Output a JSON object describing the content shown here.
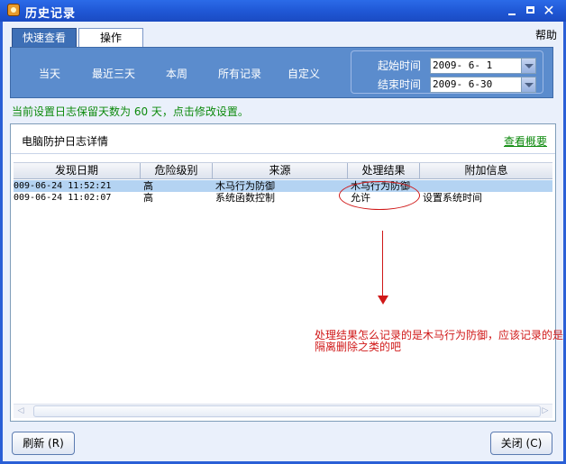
{
  "window": {
    "title": "历史记录",
    "help": "帮助"
  },
  "tabs": [
    {
      "label": "快速查看",
      "active": true
    },
    {
      "label": "操作",
      "active": false
    }
  ],
  "filter": {
    "ranges": [
      "当天",
      "最近三天",
      "本周",
      "所有记录",
      "自定义"
    ],
    "start_label": "起始时间",
    "start_value": "2009- 6- 1",
    "end_label": "结束时间",
    "end_value": "2009- 6-30"
  },
  "notice": "当前设置日志保留天数为 60 天，点击修改设置。",
  "log": {
    "title": "电脑防护日志详情",
    "summary_link": "查看概要",
    "columns": [
      "发现日期",
      "危险级别",
      "来源",
      "处理结果",
      "附加信息"
    ],
    "rows": [
      {
        "date": "009-06-24 11:52:21",
        "level": "高",
        "source": "木马行为防御",
        "result": "木马行为防御",
        "extra": "",
        "selected": true
      },
      {
        "date": "009-06-24 11:02:07",
        "level": "高",
        "source": "系统函数控制",
        "result": "允许",
        "extra": "设置系统时间",
        "selected": false
      }
    ]
  },
  "annotation": "处理结果怎么记录的是木马行为防御，应该记录的是隔离删除之类的吧",
  "buttons": {
    "refresh": "刷新 (R)",
    "close": "关闭 (C)"
  },
  "colors": {
    "titlebar": "#2b6be8",
    "panel": "#5b8ccd",
    "notice": "#0d8a0d",
    "annotation": "#d01818"
  }
}
